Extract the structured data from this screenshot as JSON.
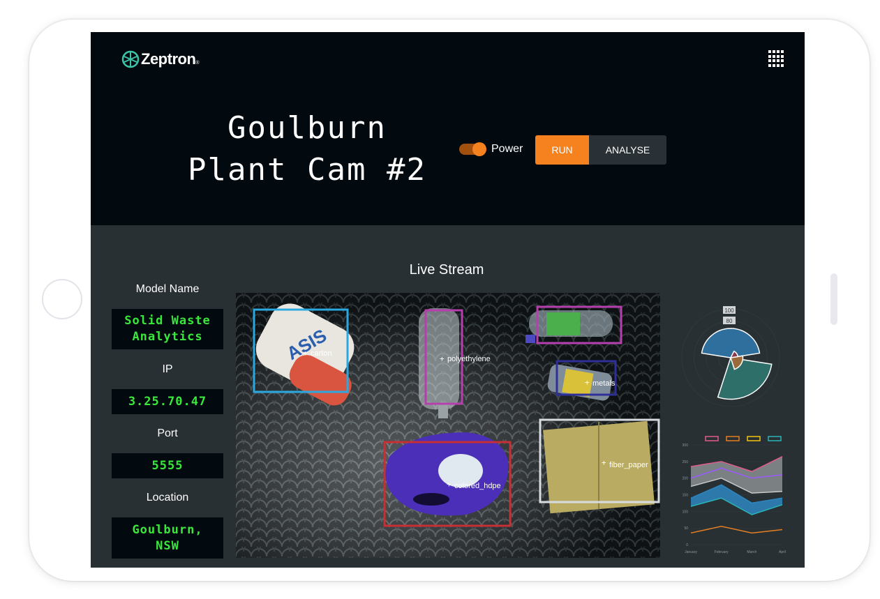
{
  "app": {
    "brand": "Zeptron",
    "brand_mark": "®",
    "title": "Goulburn\nPlant Cam #2"
  },
  "controls": {
    "power_label": "Power",
    "power_on": true,
    "run_label": "RUN",
    "analyse_label": "ANALYSE"
  },
  "colors": {
    "accent": "#f5821f",
    "readout_green": "#39e83b",
    "panel_bg": "#283034",
    "header_bg": "#020a0f"
  },
  "stream": {
    "title": "Live Stream"
  },
  "fields": [
    {
      "label": "Model Name",
      "value": "Solid Waste\nAnalytics"
    },
    {
      "label": "IP",
      "value": "3.25.70.47"
    },
    {
      "label": "Port",
      "value": "5555"
    },
    {
      "label": "Location",
      "value": "Goulburn,\nNSW"
    }
  ],
  "detections": [
    {
      "label": "carton",
      "color": "#2aa9e0"
    },
    {
      "label": "polyethylene",
      "color": "#b63fae"
    },
    {
      "label": "metals",
      "color": "#2f2f9a"
    },
    {
      "label": "colored_hdpe",
      "color": "#c62f33"
    },
    {
      "label": "fiber_paper",
      "color": "#d8dbe0"
    }
  ],
  "icons": {
    "apps": "grid-apps-icon",
    "logo": "zeptron-logo-icon"
  },
  "chart_data": [
    {
      "type": "pie",
      "title": "",
      "ticks": [
        "100",
        "80"
      ],
      "slices": [
        {
          "value": 60,
          "color": "#2e6f9e"
        },
        {
          "value": 85,
          "color": "#2f6f6a"
        },
        {
          "value": 25,
          "color": "#9a6a3a"
        },
        {
          "value": 15,
          "color": "#8a3a4a"
        }
      ]
    },
    {
      "type": "area",
      "categories": [
        "January",
        "February",
        "March",
        "April"
      ],
      "ylim": [
        0,
        300
      ],
      "yticks": [
        "0",
        "50",
        "100",
        "150",
        "200",
        "250",
        "300"
      ],
      "legend": "top",
      "series": [
        {
          "color": "#e05a8a",
          "values": [
            235,
            250,
            220,
            265
          ]
        },
        {
          "color": "#9b59ff",
          "values": [
            200,
            230,
            200,
            210
          ]
        },
        {
          "color": "#c9c9c9",
          "values": [
            175,
            200,
            155,
            160
          ]
        },
        {
          "color": "#2e86c1",
          "values": [
            140,
            180,
            125,
            140
          ]
        },
        {
          "color": "#29b6b6",
          "values": [
            115,
            140,
            90,
            120
          ]
        },
        {
          "color": "#e67e22",
          "values": [
            35,
            55,
            35,
            45
          ]
        }
      ]
    }
  ]
}
